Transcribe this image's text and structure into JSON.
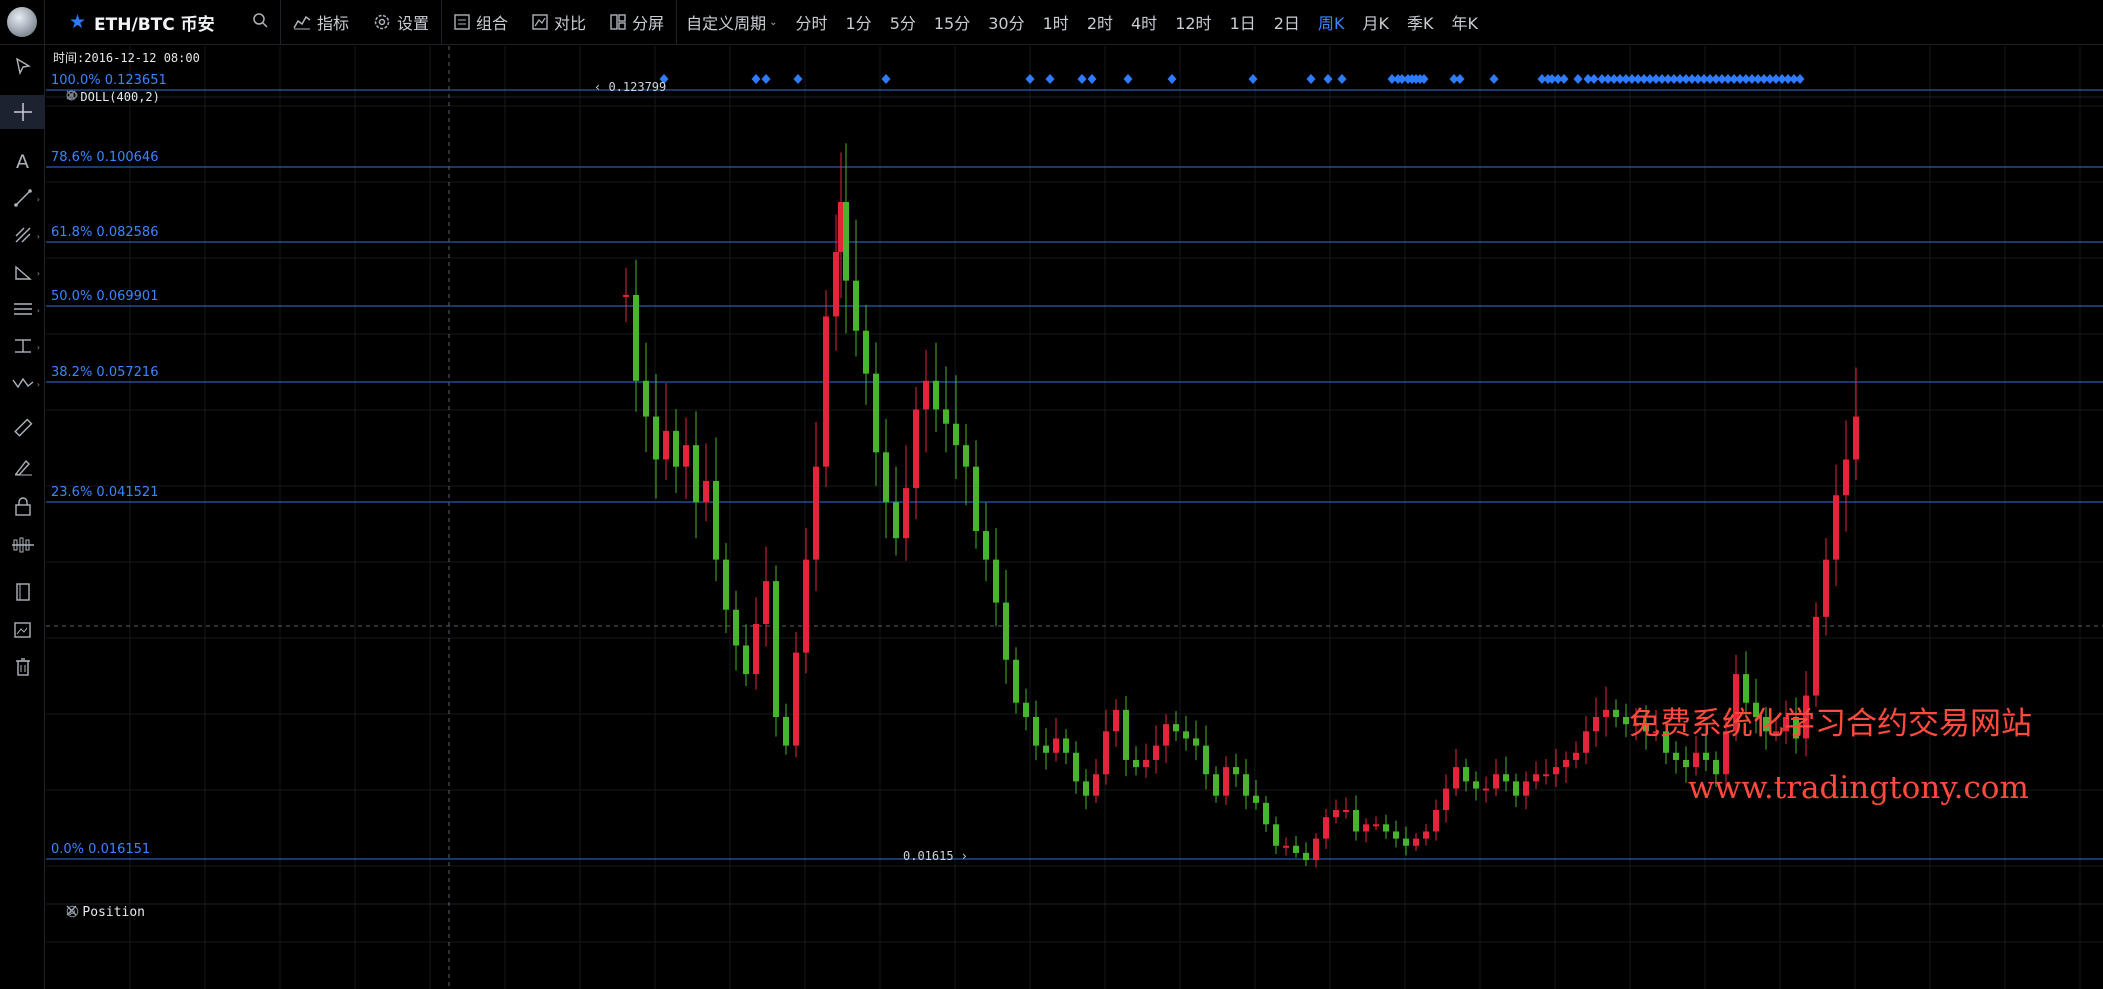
{
  "topbar": {
    "symbol": "ETH/BTC 币安",
    "tools": [
      {
        "icon": "indicator-icon",
        "label": "指标"
      },
      {
        "icon": "settings-icon",
        "label": "设置"
      },
      {
        "icon": "combo-icon",
        "label": "组合"
      },
      {
        "icon": "compare-icon",
        "label": "对比"
      },
      {
        "icon": "split-screen-icon",
        "label": "分屏"
      }
    ],
    "custom_period": "自定义周期",
    "periods": [
      "分时",
      "1分",
      "5分",
      "15分",
      "30分",
      "1时",
      "2时",
      "4时",
      "12时",
      "1日",
      "2日",
      "周K",
      "月K",
      "季K",
      "年K"
    ],
    "active_period": "周K"
  },
  "left_tools": [
    "cursor-icon",
    "crosshair-icon",
    "text-icon",
    "trendline-icon",
    "pitchfork-icon",
    "triangle-icon",
    "channel-icon",
    "ruler-text-icon",
    "wave-icon",
    "measure-icon",
    "brush-icon",
    "lock-icon",
    "magnet-icon",
    "bookmark-icon",
    "edit-image-icon",
    "trash-icon"
  ],
  "chart": {
    "time_label": "时间:2016-12-12 08:00",
    "indicator": "DOLL(400,2)",
    "position_panel": "Position",
    "high_note": "0.123799",
    "low_note": "0.01615",
    "fib_levels": [
      {
        "label": "100.0% 0.123651",
        "price": 0.123651
      },
      {
        "label": "78.6% 0.100646",
        "price": 0.100646
      },
      {
        "label": "61.8% 0.082586",
        "price": 0.082586
      },
      {
        "label": "50.0% 0.069901",
        "price": 0.069901
      },
      {
        "label": "38.2% 0.057216",
        "price": 0.057216
      },
      {
        "label": "23.6% 0.041521",
        "price": 0.041521
      },
      {
        "label": "0.0% 0.016151",
        "price": 0.016151
      }
    ],
    "colors": {
      "up": "#48b32c",
      "down": "#e5243b",
      "fib": "#2f6fdb",
      "marker": "#2f7bff",
      "bg": "#000000"
    }
  },
  "watermark": {
    "line1": "免费系统化学习合约交易网站",
    "line2": "www.tradingtony.com"
  }
}
